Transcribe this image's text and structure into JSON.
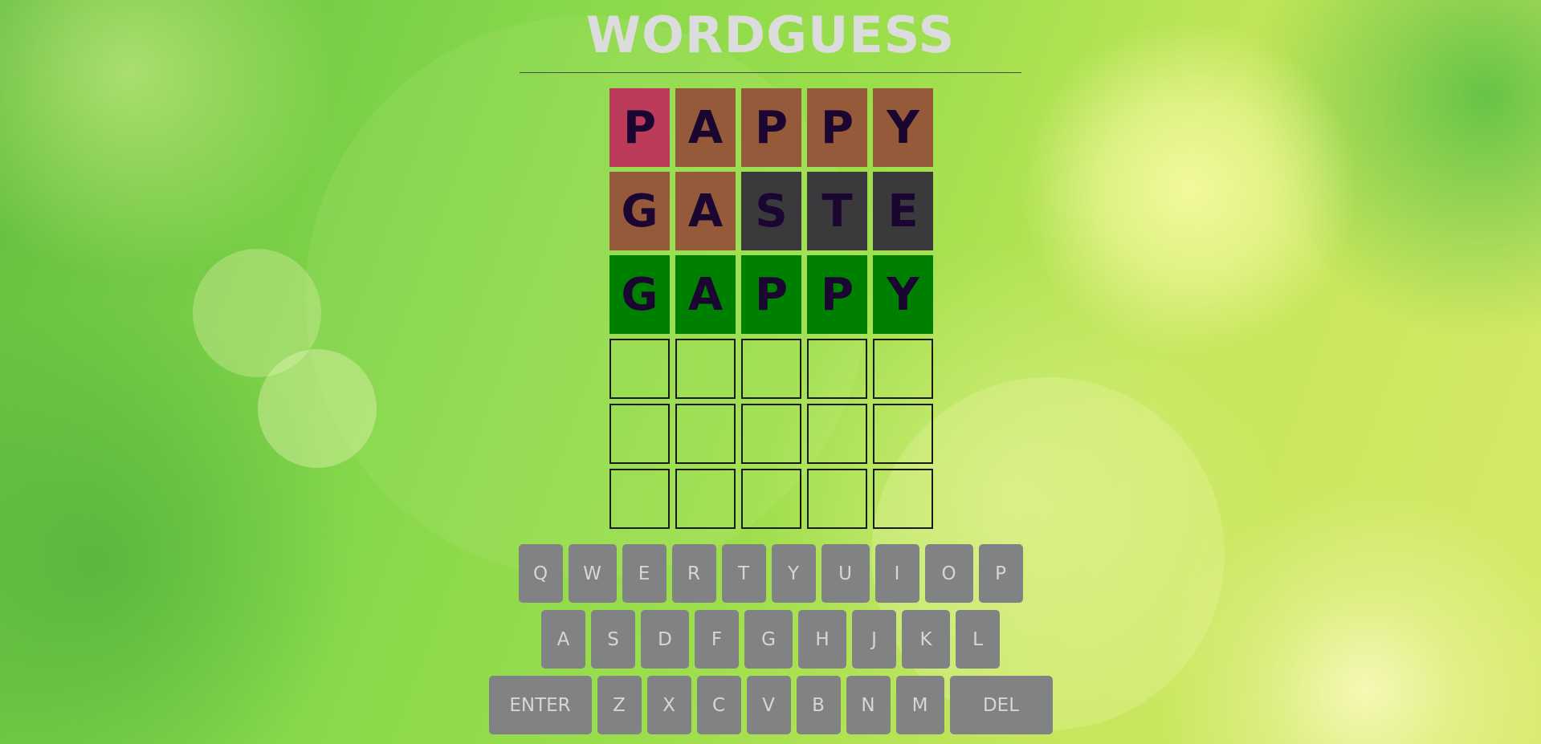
{
  "title": "WORDGUESS",
  "colors": {
    "correct": "#008000",
    "present": "#955a3a",
    "absent": "#3a3a3c",
    "highlight": "#bc3a5a",
    "letter": "#1a0630",
    "key_bg": "#818283",
    "key_text": "#d6d6d6",
    "title": "#dcdcdc"
  },
  "board": {
    "rows": [
      [
        {
          "letter": "P",
          "state": "highlight"
        },
        {
          "letter": "A",
          "state": "present"
        },
        {
          "letter": "P",
          "state": "present"
        },
        {
          "letter": "P",
          "state": "present"
        },
        {
          "letter": "Y",
          "state": "present"
        }
      ],
      [
        {
          "letter": "G",
          "state": "present"
        },
        {
          "letter": "A",
          "state": "present"
        },
        {
          "letter": "S",
          "state": "absent"
        },
        {
          "letter": "T",
          "state": "absent"
        },
        {
          "letter": "E",
          "state": "absent"
        }
      ],
      [
        {
          "letter": "G",
          "state": "correct"
        },
        {
          "letter": "A",
          "state": "correct"
        },
        {
          "letter": "P",
          "state": "correct"
        },
        {
          "letter": "P",
          "state": "correct"
        },
        {
          "letter": "Y",
          "state": "correct"
        }
      ],
      [
        {
          "letter": "",
          "state": "empty"
        },
        {
          "letter": "",
          "state": "empty"
        },
        {
          "letter": "",
          "state": "empty"
        },
        {
          "letter": "",
          "state": "empty"
        },
        {
          "letter": "",
          "state": "empty"
        }
      ],
      [
        {
          "letter": "",
          "state": "empty"
        },
        {
          "letter": "",
          "state": "empty"
        },
        {
          "letter": "",
          "state": "empty"
        },
        {
          "letter": "",
          "state": "empty"
        },
        {
          "letter": "",
          "state": "empty"
        }
      ],
      [
        {
          "letter": "",
          "state": "empty"
        },
        {
          "letter": "",
          "state": "empty"
        },
        {
          "letter": "",
          "state": "empty"
        },
        {
          "letter": "",
          "state": "empty"
        },
        {
          "letter": "",
          "state": "empty"
        }
      ]
    ]
  },
  "keyboard": {
    "rows": [
      [
        "Q",
        "W",
        "E",
        "R",
        "T",
        "Y",
        "U",
        "I",
        "O",
        "P"
      ],
      [
        "A",
        "S",
        "D",
        "F",
        "G",
        "H",
        "J",
        "K",
        "L"
      ],
      [
        "ENTER",
        "Z",
        "X",
        "C",
        "V",
        "B",
        "N",
        "M",
        "DEL"
      ]
    ]
  }
}
